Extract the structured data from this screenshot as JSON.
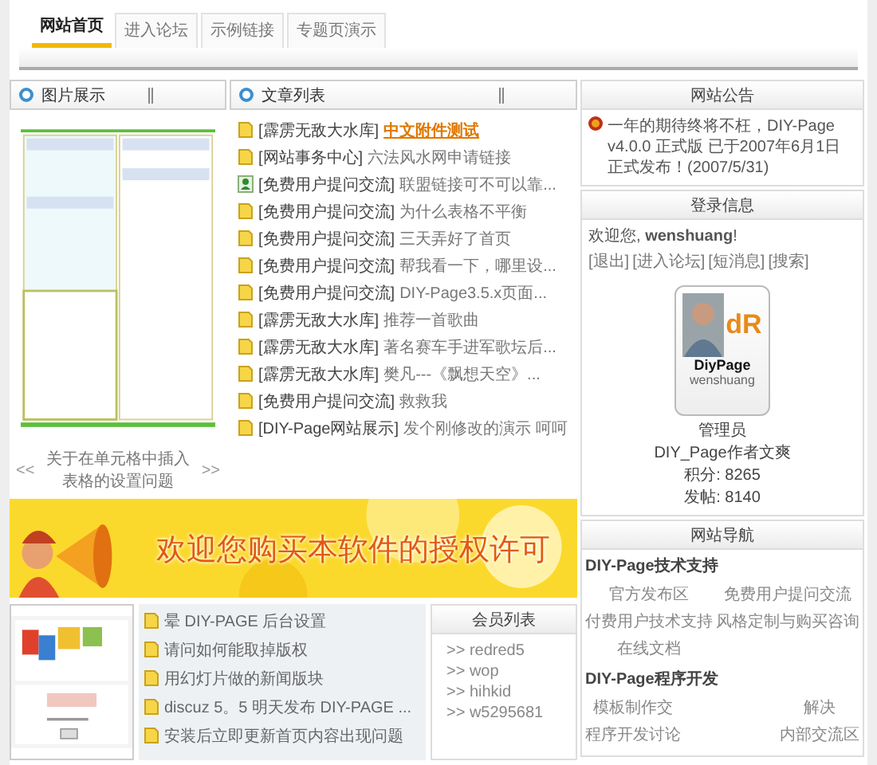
{
  "tabs": [
    {
      "label": "网站首页",
      "selected": true
    },
    {
      "label": "进入论坛",
      "selected": false
    },
    {
      "label": "示例链接",
      "selected": false
    },
    {
      "label": "专题页演示",
      "selected": false
    }
  ],
  "image_panel": {
    "title": "图片展示",
    "prev": "<<",
    "caption": "关于在单元格中插入表格的设置问题",
    "next": ">>"
  },
  "article_panel": {
    "title": "文章列表",
    "items": [
      {
        "kind": "note",
        "category": "[霹雳无敌大水库]",
        "title": "中文附件测试",
        "highlighted": true
      },
      {
        "kind": "note",
        "category": "[网站事务中心]",
        "title": "六法风水网申请链接",
        "highlighted": false
      },
      {
        "kind": "user",
        "category": "[免费用户提问交流]",
        "title": "联盟链接可不可以靠...",
        "highlighted": false
      },
      {
        "kind": "note",
        "category": "[免费用户提问交流]",
        "title": "为什么表格不平衡",
        "highlighted": false
      },
      {
        "kind": "note",
        "category": "[免费用户提问交流]",
        "title": "三天弄好了首页",
        "highlighted": false
      },
      {
        "kind": "note",
        "category": "[免费用户提问交流]",
        "title": "帮我看一下，哪里设...",
        "highlighted": false
      },
      {
        "kind": "note",
        "category": "[免费用户提问交流]",
        "title": "DIY-Page3.5.x页面...",
        "highlighted": false
      },
      {
        "kind": "note",
        "category": "[霹雳无敌大水库]",
        "title": "推荐一首歌曲",
        "highlighted": false
      },
      {
        "kind": "note",
        "category": "[霹雳无敌大水库]",
        "title": "著名赛车手进军歌坛后...",
        "highlighted": false
      },
      {
        "kind": "note",
        "category": "[霹雳无敌大水库]",
        "title": "樊凡---《飘想天空》...",
        "highlighted": false
      },
      {
        "kind": "note",
        "category": "[免费用户提问交流]",
        "title": "救救我",
        "highlighted": false
      },
      {
        "kind": "note",
        "category": "[DIY-Page网站展示]",
        "title": "发个刚修改的演示 呵呵",
        "highlighted": false
      }
    ]
  },
  "banner": {
    "text": "欢迎您购买本软件的授权许可"
  },
  "topics": [
    "晕 DIY-PAGE 后台设置",
    "请问如何能取掉版权",
    "用幻灯片做的新闻版块",
    "discuz 5。5 明天发布 DIY-PAGE ...",
    "安装后立即更新首页内容出现问题"
  ],
  "members": {
    "title": "会员列表",
    "items": [
      ">> redred5",
      ">> wop",
      ">> hihkid",
      ">> w5295681"
    ]
  },
  "announcement": {
    "title": "网站公告",
    "text": "一年的期待终将不枉，DIY-Page v4.0.0 正式版 已于2007年6月1日正式发布！(2007/5/31)"
  },
  "login": {
    "title": "登录信息",
    "welcome": "欢迎您, **wenshuang**!",
    "links": [
      "[退出]",
      "[进入论坛]",
      "[短消息]",
      "[搜索]"
    ],
    "card": {
      "logo": "dR",
      "brand": "DiyPage",
      "username": "wenshuang"
    },
    "lines": [
      "管理员",
      "DIY_Page作者文爽",
      "积分: 8265",
      "发帖: 8140"
    ]
  },
  "navigation": {
    "title": "网站导航",
    "groups": [
      {
        "title": "DIY-Page技术支持",
        "links": [
          "官方发布区",
          "免费用户提问交流",
          "付费用户技术支持",
          "风格定制与购买咨询",
          "在线文档"
        ]
      },
      {
        "title": "DIY-Page程序开发",
        "links": [
          "模板制作交",
          "解决",
          "程序开发讨论",
          "内部交流区"
        ]
      }
    ]
  }
}
